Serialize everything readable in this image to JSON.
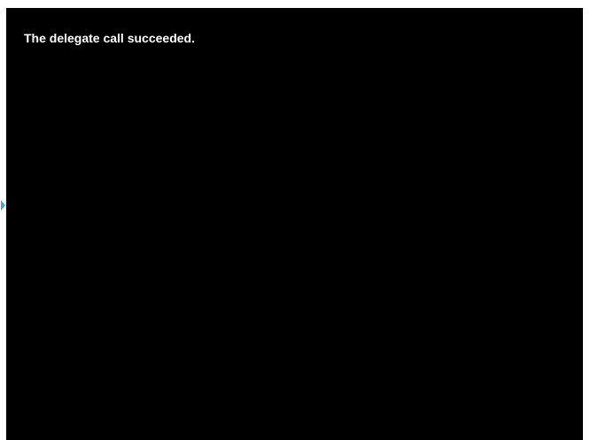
{
  "canvas": {
    "message": "The delegate call succeeded.",
    "background_color": "#000000",
    "text_color": "#ffffff"
  },
  "side_indicator": {
    "icon": "arrow-right-icon",
    "color": "#5b9bd5"
  }
}
